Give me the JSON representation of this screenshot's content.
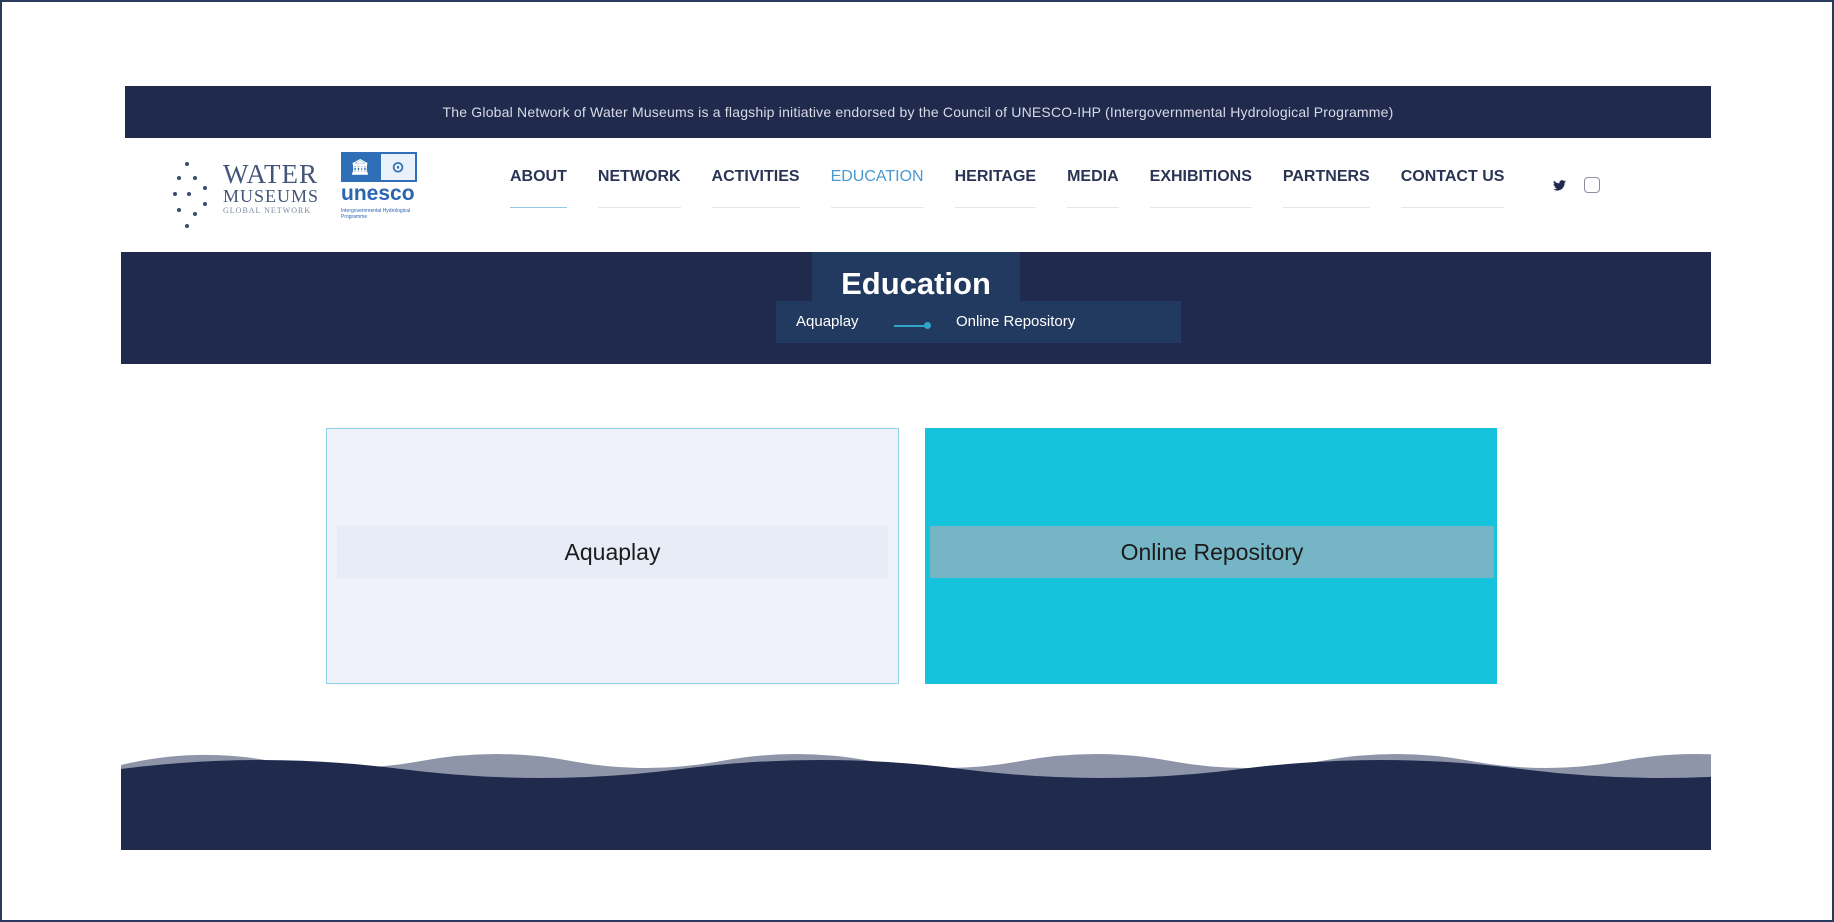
{
  "topbar": {
    "text": "The Global Network of Water Museums is a flagship initiative endorsed by the Council of UNESCO-IHP (Intergovernmental Hydrological Programme)"
  },
  "logo": {
    "line1": "WATER",
    "line2": "MUSEUMS",
    "line3": "GLOBAL NETWORK",
    "unesco_name": "unesco",
    "unesco_sub": "Intergovernmental Hydrological Programme"
  },
  "nav": {
    "items": [
      {
        "label": "ABOUT"
      },
      {
        "label": "NETWORK"
      },
      {
        "label": "ACTIVITIES"
      },
      {
        "label": "EDUCATION"
      },
      {
        "label": "HERITAGE"
      },
      {
        "label": "MEDIA"
      },
      {
        "label": "EXHIBITIONS"
      },
      {
        "label": "PARTNERS"
      },
      {
        "label": "CONTACT US"
      }
    ],
    "active": "EDUCATION"
  },
  "social": {
    "icons": [
      "twitter-icon",
      "instagram-icon"
    ]
  },
  "banner": {
    "title": "Education",
    "breadcrumb": [
      "Aquaplay",
      "Online Repository"
    ]
  },
  "cards": [
    {
      "label": "Aquaplay"
    },
    {
      "label": "Online Repository"
    }
  ],
  "colors": {
    "navy": "#1f2a4d",
    "accent": "#16c3dd",
    "active_nav": "#4a98cf"
  }
}
